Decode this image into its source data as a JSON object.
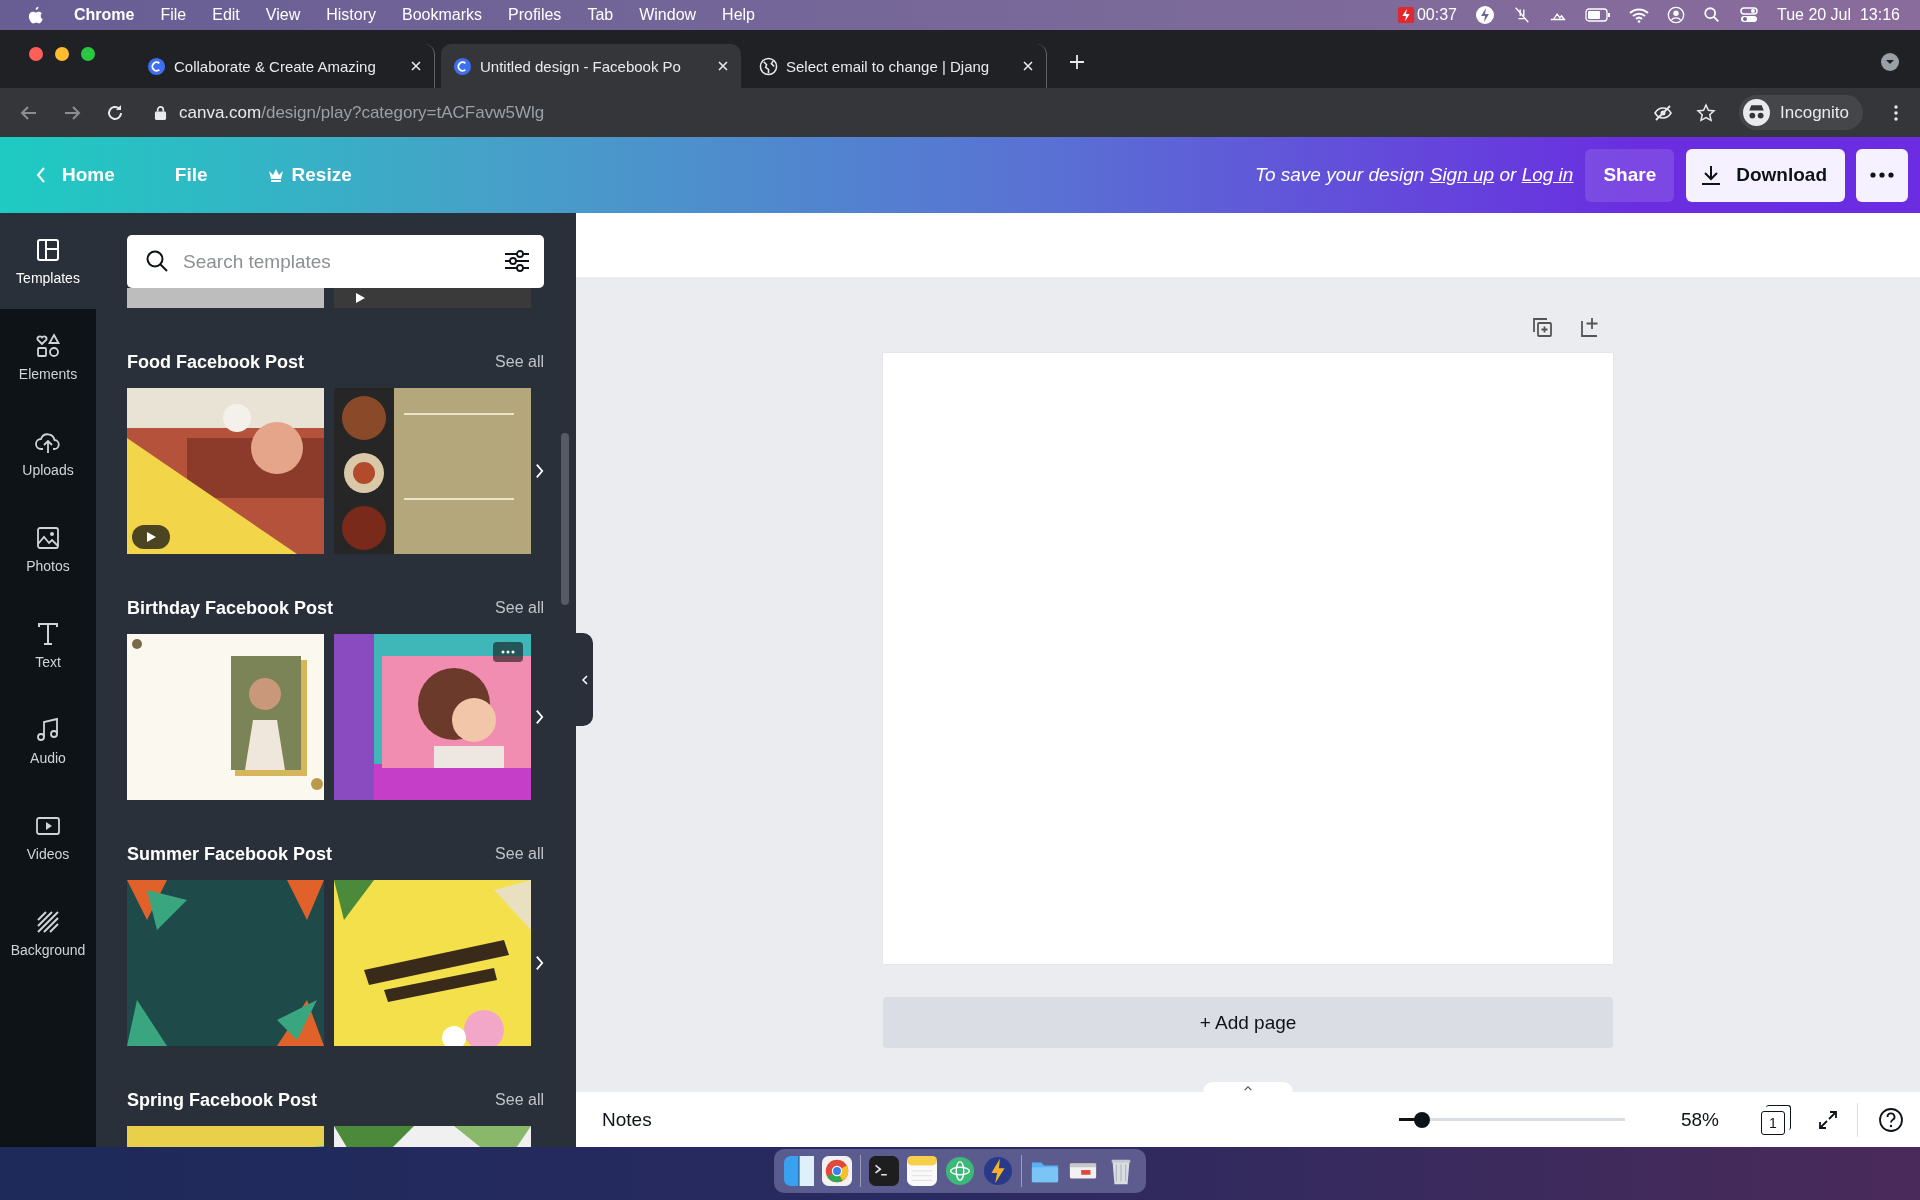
{
  "menu_bar": {
    "app": "Chrome",
    "items": [
      "File",
      "Edit",
      "View",
      "History",
      "Bookmarks",
      "Profiles",
      "Tab",
      "Window",
      "Help"
    ],
    "battery_time": "00:37",
    "clock": "Tue 20 Jul  13:16"
  },
  "browser": {
    "tabs": [
      {
        "title": "Collaborate & Create Amazing",
        "kind": "logo",
        "selected": false
      },
      {
        "title": "Untitled design - Facebook Po",
        "kind": "logo",
        "selected": true
      },
      {
        "title": "Select email to change | Djang",
        "kind": "globe",
        "selected": false
      }
    ],
    "url_host": "canva.com",
    "url_path": "/design/play?category=tACFavw5Wlg",
    "profile": "Incognito"
  },
  "header": {
    "nav": [
      {
        "label": "Home",
        "kind": "back"
      },
      {
        "label": "File",
        "kind": "plain"
      },
      {
        "label": "Resize",
        "kind": "crown"
      }
    ],
    "save_text": "To save your design",
    "sign_up": "Sign up",
    "or": "or",
    "log_in": "Log in",
    "share": "Share",
    "download": "Download"
  },
  "sidebar": {
    "items": [
      {
        "label": "Templates",
        "kind": "templates",
        "selected": true
      },
      {
        "label": "Elements",
        "kind": "elements",
        "selected": false
      },
      {
        "label": "Uploads",
        "kind": "uploads",
        "selected": false
      },
      {
        "label": "Photos",
        "kind": "photos",
        "selected": false
      },
      {
        "label": "Text",
        "kind": "text",
        "selected": false
      },
      {
        "label": "Audio",
        "kind": "audio",
        "selected": false
      },
      {
        "label": "Videos",
        "kind": "videos",
        "selected": false
      },
      {
        "label": "Background",
        "kind": "background",
        "selected": false
      }
    ]
  },
  "panel": {
    "search": {
      "placeholder": "Search templates"
    },
    "partial_row": [
      {
        "kind": "picture"
      },
      {
        "kind": "picture",
        "video": true
      }
    ],
    "sections": [
      {
        "title": "Food Facebook Post",
        "see_all": "See all",
        "thumbnails": [
          {
            "kind": "picture",
            "video": true
          },
          {
            "kind": "picture"
          }
        ]
      },
      {
        "title": "Birthday Facebook Post",
        "see_all": "See all",
        "thumbnails": [
          {
            "kind": "picture"
          },
          {
            "kind": "picture",
            "menu": true
          }
        ]
      },
      {
        "title": "Summer Facebook Post",
        "see_all": "See all",
        "thumbnails": [
          {
            "kind": "picture"
          },
          {
            "kind": "picture"
          }
        ]
      },
      {
        "title": "Spring Facebook Post",
        "see_all": "See all",
        "thumbnails": [
          {
            "kind": "picture"
          },
          {
            "kind": "picture"
          }
        ]
      }
    ]
  },
  "canvas": {
    "add_page": "+ Add page"
  },
  "footer": {
    "notes": "Notes",
    "zoom": {
      "level": 0.1,
      "reading": "58%"
    },
    "page_count": "1"
  }
}
